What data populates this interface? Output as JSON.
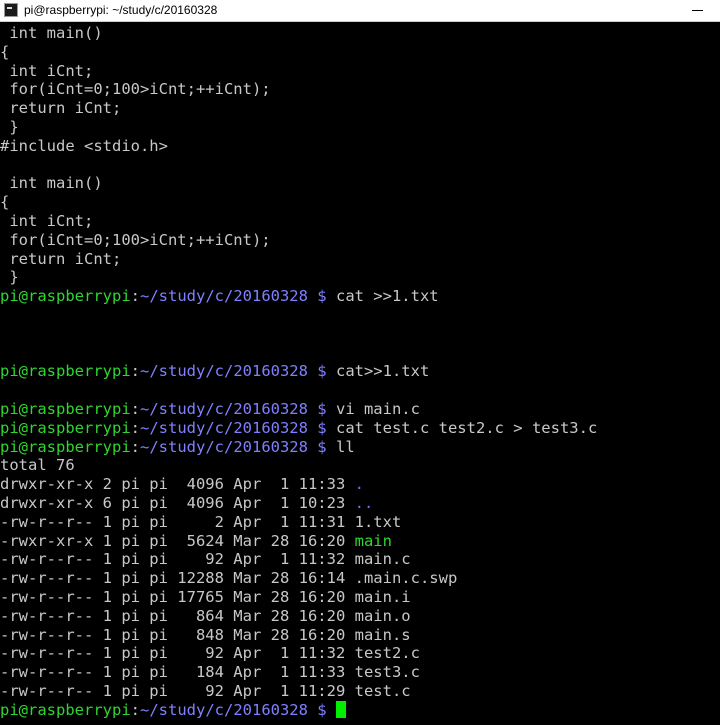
{
  "window": {
    "title": "pi@raspberrypi: ~/study/c/20160328",
    "minimize_glyph": "—"
  },
  "prompt": {
    "user": "pi@raspberrypi",
    "path": "~/study/c/20160328 $"
  },
  "lines": [
    {
      "type": "text",
      "text": " int main()"
    },
    {
      "type": "text",
      "text": "{"
    },
    {
      "type": "text",
      "text": " int iCnt;"
    },
    {
      "type": "text",
      "text": " for(iCnt=0;100>iCnt;++iCnt);"
    },
    {
      "type": "text",
      "text": " return iCnt;"
    },
    {
      "type": "text",
      "text": " }"
    },
    {
      "type": "text",
      "text": "#include <stdio.h>"
    },
    {
      "type": "text",
      "text": ""
    },
    {
      "type": "text",
      "text": " int main()"
    },
    {
      "type": "text",
      "text": "{"
    },
    {
      "type": "text",
      "text": " int iCnt;"
    },
    {
      "type": "text",
      "text": " for(iCnt=0;100>iCnt;++iCnt);"
    },
    {
      "type": "text",
      "text": " return iCnt;"
    },
    {
      "type": "text",
      "text": " }"
    },
    {
      "type": "prompt",
      "cmd": "cat >>1.txt"
    },
    {
      "type": "text",
      "text": ""
    },
    {
      "type": "text",
      "text": ""
    },
    {
      "type": "text",
      "text": ""
    },
    {
      "type": "prompt",
      "cmd": "cat>>1.txt"
    },
    {
      "type": "text",
      "text": ""
    },
    {
      "type": "prompt",
      "cmd": "vi main.c"
    },
    {
      "type": "prompt",
      "cmd": "cat test.c test2.c > test3.c"
    },
    {
      "type": "prompt",
      "cmd": "ll"
    },
    {
      "type": "text",
      "text": "total 76"
    },
    {
      "type": "ls",
      "meta": "drwxr-xr-x 2 pi pi  4096 Apr  1 11:33",
      "name": ".",
      "kind": "dir"
    },
    {
      "type": "ls",
      "meta": "drwxr-xr-x 6 pi pi  4096 Apr  1 10:23",
      "name": "..",
      "kind": "dir"
    },
    {
      "type": "ls",
      "meta": "-rw-r--r-- 1 pi pi     2 Apr  1 11:31",
      "name": "1.txt",
      "kind": "file"
    },
    {
      "type": "ls",
      "meta": "-rwxr-xr-x 1 pi pi  5624 Mar 28 16:20",
      "name": "main",
      "kind": "exec"
    },
    {
      "type": "ls",
      "meta": "-rw-r--r-- 1 pi pi    92 Apr  1 11:32",
      "name": "main.c",
      "kind": "file"
    },
    {
      "type": "ls",
      "meta": "-rw-r--r-- 1 pi pi 12288 Mar 28 16:14",
      "name": ".main.c.swp",
      "kind": "file"
    },
    {
      "type": "ls",
      "meta": "-rw-r--r-- 1 pi pi 17765 Mar 28 16:20",
      "name": "main.i",
      "kind": "file"
    },
    {
      "type": "ls",
      "meta": "-rw-r--r-- 1 pi pi   864 Mar 28 16:20",
      "name": "main.o",
      "kind": "file"
    },
    {
      "type": "ls",
      "meta": "-rw-r--r-- 1 pi pi   848 Mar 28 16:20",
      "name": "main.s",
      "kind": "file"
    },
    {
      "type": "ls",
      "meta": "-rw-r--r-- 1 pi pi    92 Apr  1 11:32",
      "name": "test2.c",
      "kind": "file"
    },
    {
      "type": "ls",
      "meta": "-rw-r--r-- 1 pi pi   184 Apr  1 11:33",
      "name": "test3.c",
      "kind": "file"
    },
    {
      "type": "ls",
      "meta": "-rw-r--r-- 1 pi pi    92 Apr  1 11:29",
      "name": "test.c",
      "kind": "file"
    },
    {
      "type": "prompt",
      "cmd": "",
      "cursor": true
    }
  ],
  "colors": {
    "background": "#000000",
    "text": "#c8c8c8",
    "prompt_user": "#2fd62f",
    "prompt_path": "#8080ff",
    "directory": "#6e6eff",
    "executable": "#2fd62f",
    "cursor": "#00ee00"
  }
}
